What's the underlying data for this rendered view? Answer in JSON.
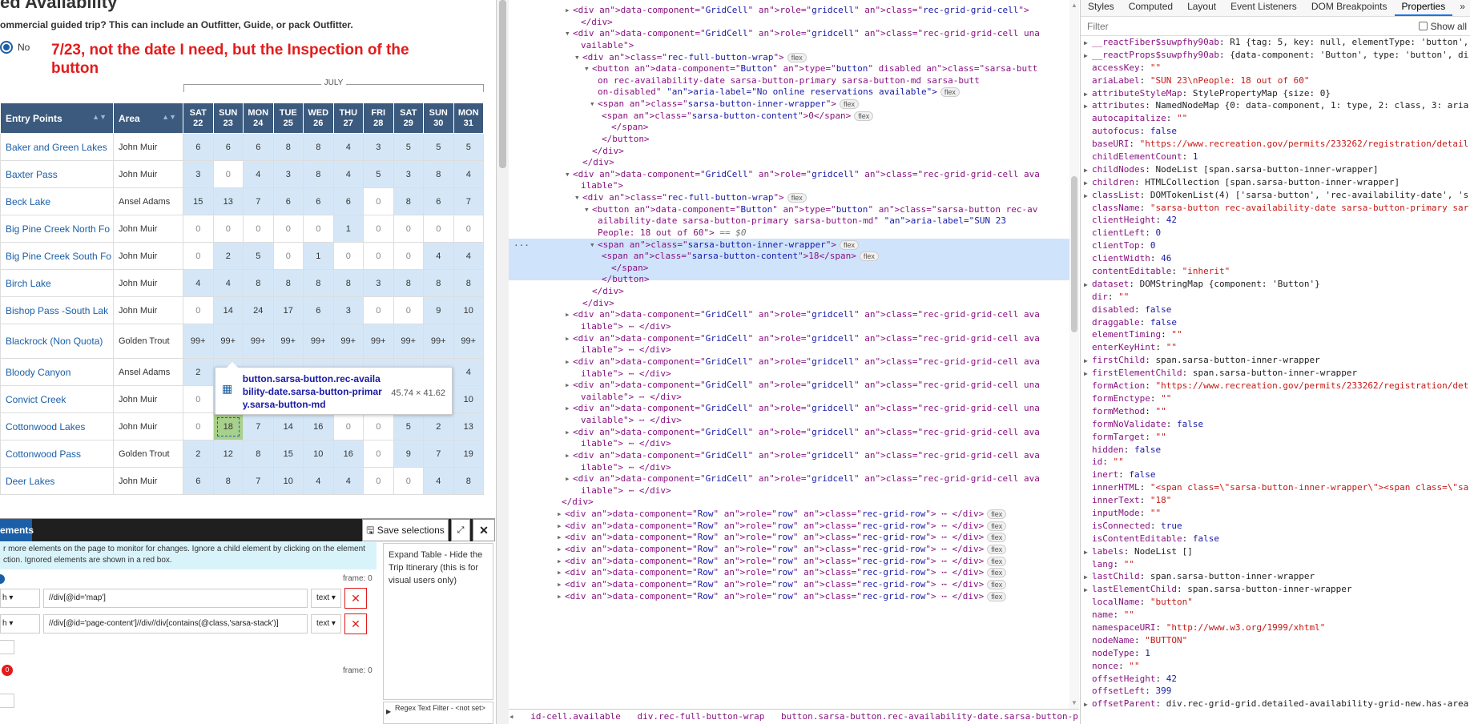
{
  "page": {
    "title": "ed Availability",
    "question": "ommercial guided trip? This can include an Outfitter, Guide, or pack Outfitter.",
    "radio_no_label": "No",
    "annotation": "7/23, not the date I need, but the Inspection of the button",
    "month_label": "JULY",
    "headers": {
      "entry_points": "Entry Points",
      "area": "Area"
    },
    "days": [
      {
        "dow": "SAT",
        "d": "22"
      },
      {
        "dow": "SUN",
        "d": "23"
      },
      {
        "dow": "MON",
        "d": "24"
      },
      {
        "dow": "TUE",
        "d": "25"
      },
      {
        "dow": "WED",
        "d": "26"
      },
      {
        "dow": "THU",
        "d": "27"
      },
      {
        "dow": "FRI",
        "d": "28"
      },
      {
        "dow": "SAT",
        "d": "29"
      },
      {
        "dow": "SUN",
        "d": "30"
      },
      {
        "dow": "MON",
        "d": "31"
      }
    ],
    "rows": [
      {
        "name": "Baker and Green Lakes",
        "area": "John Muir",
        "vals": [
          "6",
          "6",
          "6",
          "8",
          "8",
          "4",
          "3",
          "5",
          "5",
          "5"
        ]
      },
      {
        "name": "Baxter Pass",
        "area": "John Muir",
        "vals": [
          "3",
          "0",
          "4",
          "3",
          "8",
          "4",
          "5",
          "3",
          "8",
          "4"
        ]
      },
      {
        "name": "Beck Lake",
        "area": "Ansel Adams",
        "vals": [
          "15",
          "13",
          "7",
          "6",
          "6",
          "6",
          "0",
          "8",
          "6",
          "7"
        ]
      },
      {
        "name": "Big Pine Creek North Fo",
        "area": "John Muir",
        "vals": [
          "0",
          "0",
          "0",
          "0",
          "0",
          "1",
          "0",
          "0",
          "0",
          "0"
        ]
      },
      {
        "name": "Big Pine Creek South Fo",
        "area": "John Muir",
        "vals": [
          "0",
          "2",
          "5",
          "0",
          "1",
          "0",
          "0",
          "0",
          "4",
          "4"
        ]
      },
      {
        "name": "Birch Lake",
        "area": "John Muir",
        "vals": [
          "4",
          "4",
          "8",
          "8",
          "8",
          "8",
          "3",
          "8",
          "8",
          "8"
        ]
      },
      {
        "name": "Bishop Pass -South Lak",
        "area": "John Muir",
        "vals": [
          "0",
          "14",
          "24",
          "17",
          "6",
          "3",
          "0",
          "0",
          "9",
          "10"
        ]
      },
      {
        "name": "Blackrock (Non Quota)",
        "area": "Golden Trout",
        "vals": [
          "99+",
          "99+",
          "99+",
          "99+",
          "99+",
          "99+",
          "99+",
          "99+",
          "99+",
          "99+"
        ]
      },
      {
        "name": "Bloody Canyon",
        "area": "Ansel Adams",
        "vals": [
          "2",
          "",
          "",
          "",
          "",
          "",
          "",
          "",
          "",
          "4"
        ]
      },
      {
        "name": "Convict Creek",
        "area": "John Muir",
        "vals": [
          "0",
          "",
          "",
          "",
          "",
          "",
          "",
          "",
          "",
          "10"
        ]
      },
      {
        "name": "Cottonwood Lakes",
        "area": "John Muir",
        "vals": [
          "0",
          "18",
          "7",
          "14",
          "16",
          "0",
          "0",
          "5",
          "2",
          "13"
        ]
      },
      {
        "name": "Cottonwood Pass",
        "area": "Golden Trout",
        "vals": [
          "2",
          "12",
          "8",
          "15",
          "10",
          "16",
          "0",
          "9",
          "7",
          "19"
        ]
      },
      {
        "name": "Deer Lakes",
        "area": "John Muir",
        "vals": [
          "6",
          "8",
          "7",
          "10",
          "4",
          "4",
          "0",
          "0",
          "4",
          "8"
        ]
      }
    ],
    "tooltip": {
      "selector": "button.sarsa-button.rec-availability-date.sarsa-button-primary.sarsa-button-md",
      "size": "45.74 × 41.62"
    }
  },
  "extension": {
    "tab": "ements",
    "save": "Save selections",
    "info": "r more elements on the page to monitor for changes. Ignore a child element by clicking on the element ction. Ignored elements are shown in a red box.",
    "frame": "frame: 0",
    "row1": {
      "type": "h",
      "xpath": "//div[@id='map']",
      "mode": "text"
    },
    "row2": {
      "type": "h",
      "xpath": "//div[@id='page-content']//div//div[contains(@class,'sarsa-stack')]",
      "mode": "text"
    },
    "badge": "0",
    "frame2": "frame: 0",
    "right_note": "Expand Table - Hide the Trip Itinerary (this is for visual users only)",
    "regex": "Regex Text Filter - <not set>"
  },
  "dom_lines": [
    "<div data-component=\"GridCell\" role=\"gridcell\" class=\"rec-grid-grid-cell\">",
    "</div>",
    "<div data-component=\"GridCell\" role=\"gridcell\" class=\"rec-grid-grid-cell una",
    "vailable\">",
    "<div class=\"rec-full-button-wrap\">",
    "<button data-component=\"Button\" type=\"button\" disabled class=\"sarsa-butt",
    "on rec-availability-date sarsa-button-primary sarsa-button-md sarsa-butt",
    "on-disabled\" aria-label=\"No online reservations available\">",
    "<span class=\"sarsa-button-inner-wrapper\">",
    "<span class=\"sarsa-button-content\">0</span>",
    "</span>",
    "</button>",
    "</div>",
    "</div>",
    "<div data-component=\"GridCell\" role=\"gridcell\" class=\"rec-grid-grid-cell ava",
    "ilable\">",
    "<div class=\"rec-full-button-wrap\">",
    "<button data-component=\"Button\" type=\"button\" class=\"sarsa-button rec-av",
    "ailability-date sarsa-button-primary sarsa-button-md\" aria-label=\"SUN 23",
    "People: 18 out of 60\">",
    "<span class=\"sarsa-button-inner-wrapper\">",
    "<span class=\"sarsa-button-content\">18</span>",
    "</span>",
    "</button>",
    "</div>",
    "</div>",
    "<div data-component=\"GridCell\" role=\"gridcell\" class=\"rec-grid-grid-cell ava",
    "ilable\"> ⋯ </div>",
    "<div data-component=\"GridCell\" role=\"gridcell\" class=\"rec-grid-grid-cell ava",
    "ilable\"> ⋯ </div>",
    "<div data-component=\"GridCell\" role=\"gridcell\" class=\"rec-grid-grid-cell ava",
    "ilable\"> ⋯ </div>",
    "<div data-component=\"GridCell\" role=\"gridcell\" class=\"rec-grid-grid-cell una",
    "vailable\"> ⋯ </div>",
    "<div data-component=\"GridCell\" role=\"gridcell\" class=\"rec-grid-grid-cell una",
    "vailable\"> ⋯ </div>",
    "<div data-component=\"GridCell\" role=\"gridcell\" class=\"rec-grid-grid-cell ava",
    "ilable\"> ⋯ </div>",
    "<div data-component=\"GridCell\" role=\"gridcell\" class=\"rec-grid-grid-cell ava",
    "ilable\"> ⋯ </div>",
    "<div data-component=\"GridCell\" role=\"gridcell\" class=\"rec-grid-grid-cell ava",
    "ilable\"> ⋯ </div>",
    "</div>",
    "<div data-component=\"Row\" role=\"row\" class=\"rec-grid-row\"> ⋯ </div>",
    "<div data-component=\"Row\" role=\"row\" class=\"rec-grid-row\"> ⋯ </div>",
    "<div data-component=\"Row\" role=\"row\" class=\"rec-grid-row\"> ⋯ </div>",
    "<div data-component=\"Row\" role=\"row\" class=\"rec-grid-row\"> ⋯ </div>",
    "<div data-component=\"Row\" role=\"row\" class=\"rec-grid-row\"> ⋯ </div>",
    "<div data-component=\"Row\" role=\"row\" class=\"rec-grid-row\"> ⋯ </div>",
    "<div data-component=\"Row\" role=\"row\" class=\"rec-grid-row\"> ⋯ </div>",
    "<div data-component=\"Row\" role=\"row\" class=\"rec-grid-row\"> ⋯ </div>"
  ],
  "dom_badges": {
    "flex": "flex",
    "eq": "== $0"
  },
  "breadcrumbs": [
    "id-cell.available",
    "div.rec-full-button-wrap",
    "button.sarsa-button.rec-availability-date.sarsa-button-primary.sarsa-button-md"
  ],
  "props_tabs": [
    "Styles",
    "Computed",
    "Layout",
    "Event Listeners",
    "DOM Breakpoints",
    "Properties"
  ],
  "props_filter": "Filter",
  "props_showall": "Show all",
  "props": [
    {
      "k": "__reactFiber$suwpfhy90ab",
      "v": "R1 {tag: 5, key: null, elementType: 'button', s",
      "t": "o",
      "tri": true
    },
    {
      "k": "__reactProps$suwpfhy90ab",
      "v": "{data-component: 'Button', type: 'button', di",
      "t": "o",
      "tri": true
    },
    {
      "k": "accessKey",
      "v": "\"\"",
      "t": "s"
    },
    {
      "k": "ariaLabel",
      "v": "\"SUN 23\\nPeople: 18 out of 60\"",
      "t": "s"
    },
    {
      "k": "attributeStyleMap",
      "v": "StylePropertyMap {size: 0}",
      "t": "o",
      "tri": true
    },
    {
      "k": "attributes",
      "v": "NamedNodeMap {0: data-component, 1: type, 2: class, 3: aria",
      "t": "o",
      "tri": true
    },
    {
      "k": "autocapitalize",
      "v": "\"\"",
      "t": "s"
    },
    {
      "k": "autofocus",
      "v": "false",
      "t": "v"
    },
    {
      "k": "baseURI",
      "v": "\"https://www.recreation.gov/permits/233262/registration/detail",
      "t": "s"
    },
    {
      "k": "childElementCount",
      "v": "1",
      "t": "v"
    },
    {
      "k": "childNodes",
      "v": "NodeList [span.sarsa-button-inner-wrapper]",
      "t": "o",
      "tri": true
    },
    {
      "k": "children",
      "v": "HTMLCollection [span.sarsa-button-inner-wrapper]",
      "t": "o",
      "tri": true
    },
    {
      "k": "classList",
      "v": "DOMTokenList(4) ['sarsa-button', 'rec-availability-date', 's",
      "t": "o",
      "tri": true
    },
    {
      "k": "className",
      "v": "\"sarsa-button rec-availability-date sarsa-button-primary sar",
      "t": "s"
    },
    {
      "k": "clientHeight",
      "v": "42",
      "t": "v"
    },
    {
      "k": "clientLeft",
      "v": "0",
      "t": "v"
    },
    {
      "k": "clientTop",
      "v": "0",
      "t": "v"
    },
    {
      "k": "clientWidth",
      "v": "46",
      "t": "v"
    },
    {
      "k": "contentEditable",
      "v": "\"inherit\"",
      "t": "s"
    },
    {
      "k": "dataset",
      "v": "DOMStringMap {component: 'Button'}",
      "t": "o",
      "tri": true
    },
    {
      "k": "dir",
      "v": "\"\"",
      "t": "s"
    },
    {
      "k": "disabled",
      "v": "false",
      "t": "v"
    },
    {
      "k": "draggable",
      "v": "false",
      "t": "v"
    },
    {
      "k": "elementTiming",
      "v": "\"\"",
      "t": "s"
    },
    {
      "k": "enterKeyHint",
      "v": "\"\"",
      "t": "s"
    },
    {
      "k": "firstChild",
      "v": "span.sarsa-button-inner-wrapper",
      "t": "o",
      "tri": true
    },
    {
      "k": "firstElementChild",
      "v": "span.sarsa-button-inner-wrapper",
      "t": "o",
      "tri": true
    },
    {
      "k": "formAction",
      "v": "\"https://www.recreation.gov/permits/233262/registration/det",
      "t": "s"
    },
    {
      "k": "formEnctype",
      "v": "\"\"",
      "t": "s"
    },
    {
      "k": "formMethod",
      "v": "\"\"",
      "t": "s"
    },
    {
      "k": "formNoValidate",
      "v": "false",
      "t": "v"
    },
    {
      "k": "formTarget",
      "v": "\"\"",
      "t": "s"
    },
    {
      "k": "hidden",
      "v": "false",
      "t": "v"
    },
    {
      "k": "id",
      "v": "\"\"",
      "t": "s"
    },
    {
      "k": "inert",
      "v": "false",
      "t": "v"
    },
    {
      "k": "innerHTML",
      "v": "\"<span class=\\\"sarsa-button-inner-wrapper\\\"><span class=\\\"sa",
      "t": "s"
    },
    {
      "k": "innerText",
      "v": "\"18\"",
      "t": "s"
    },
    {
      "k": "inputMode",
      "v": "\"\"",
      "t": "s"
    },
    {
      "k": "isConnected",
      "v": "true",
      "t": "v"
    },
    {
      "k": "isContentEditable",
      "v": "false",
      "t": "v"
    },
    {
      "k": "labels",
      "v": "NodeList []",
      "t": "o",
      "tri": true
    },
    {
      "k": "lang",
      "v": "\"\"",
      "t": "s"
    },
    {
      "k": "lastChild",
      "v": "span.sarsa-button-inner-wrapper",
      "t": "o",
      "tri": true
    },
    {
      "k": "lastElementChild",
      "v": "span.sarsa-button-inner-wrapper",
      "t": "o",
      "tri": true
    },
    {
      "k": "localName",
      "v": "\"button\"",
      "t": "s"
    },
    {
      "k": "name",
      "v": "\"\"",
      "t": "s"
    },
    {
      "k": "namespaceURI",
      "v": "\"http://www.w3.org/1999/xhtml\"",
      "t": "s"
    },
    {
      "k": "nodeName",
      "v": "\"BUTTON\"",
      "t": "s"
    },
    {
      "k": "nodeType",
      "v": "1",
      "t": "v"
    },
    {
      "k": "nonce",
      "v": "\"\"",
      "t": "s"
    },
    {
      "k": "offsetHeight",
      "v": "42",
      "t": "v"
    },
    {
      "k": "offsetLeft",
      "v": "399",
      "t": "v"
    },
    {
      "k": "offsetParent",
      "v": "div.rec-grid-grid.detailed-availability-grid-new.has-area",
      "t": "o",
      "tri": true
    }
  ]
}
